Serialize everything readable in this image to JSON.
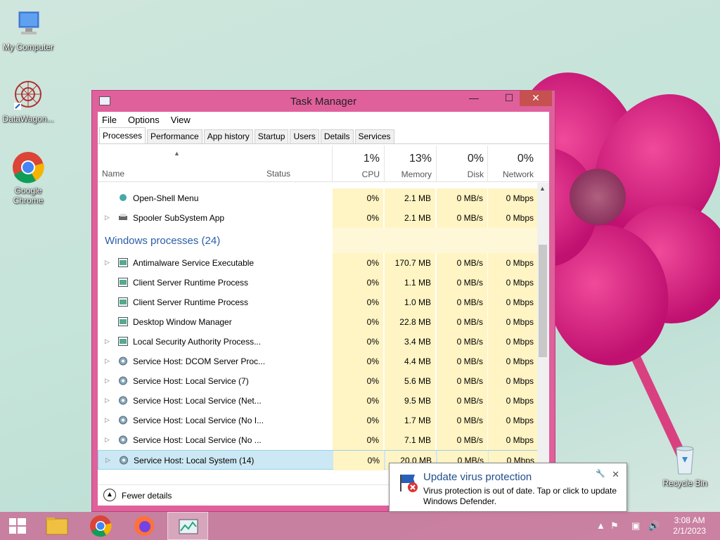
{
  "desktop": {
    "icons": [
      {
        "label": "My Computer"
      },
      {
        "label": "DataWagon..."
      },
      {
        "label": "Google Chrome"
      },
      {
        "label": "Recycle Bin"
      }
    ]
  },
  "window": {
    "title": "Task Manager",
    "controls": {
      "minimize": "—",
      "maximize": "☐",
      "close": "✕"
    },
    "menu": [
      "File",
      "Options",
      "View"
    ],
    "tabs": [
      "Processes",
      "Performance",
      "App history",
      "Startup",
      "Users",
      "Details",
      "Services"
    ],
    "active_tab": "Processes",
    "header": {
      "name": "Name",
      "status": "Status",
      "cpu_pct": "1%",
      "cpu": "CPU",
      "mem_pct": "13%",
      "mem": "Memory",
      "disk_pct": "0%",
      "disk": "Disk",
      "net_pct": "0%",
      "net": "Network"
    },
    "rows_top": [
      {
        "name": "Open-Shell Menu",
        "cpu": "0%",
        "mem": "2.1 MB",
        "disk": "0 MB/s",
        "net": "0 Mbps"
      },
      {
        "name": "Spooler SubSystem App",
        "cpu": "0%",
        "mem": "2.1 MB",
        "disk": "0 MB/s",
        "net": "0 Mbps"
      }
    ],
    "group_label": "Windows processes (24)",
    "rows": [
      {
        "name": "Antimalware Service Executable",
        "cpu": "0%",
        "mem": "170.7 MB",
        "disk": "0 MB/s",
        "net": "0 Mbps"
      },
      {
        "name": "Client Server Runtime Process",
        "cpu": "0%",
        "mem": "1.1 MB",
        "disk": "0 MB/s",
        "net": "0 Mbps"
      },
      {
        "name": "Client Server Runtime Process",
        "cpu": "0%",
        "mem": "1.0 MB",
        "disk": "0 MB/s",
        "net": "0 Mbps"
      },
      {
        "name": "Desktop Window Manager",
        "cpu": "0%",
        "mem": "22.8 MB",
        "disk": "0 MB/s",
        "net": "0 Mbps"
      },
      {
        "name": "Local Security Authority Process...",
        "cpu": "0%",
        "mem": "3.4 MB",
        "disk": "0 MB/s",
        "net": "0 Mbps"
      },
      {
        "name": "Service Host: DCOM Server Proc...",
        "cpu": "0%",
        "mem": "4.4 MB",
        "disk": "0 MB/s",
        "net": "0 Mbps"
      },
      {
        "name": "Service Host: Local Service (7)",
        "cpu": "0%",
        "mem": "5.6 MB",
        "disk": "0 MB/s",
        "net": "0 Mbps"
      },
      {
        "name": "Service Host: Local Service (Net...",
        "cpu": "0%",
        "mem": "9.5 MB",
        "disk": "0 MB/s",
        "net": "0 Mbps"
      },
      {
        "name": "Service Host: Local Service (No I...",
        "cpu": "0%",
        "mem": "1.7 MB",
        "disk": "0 MB/s",
        "net": "0 Mbps"
      },
      {
        "name": "Service Host: Local Service (No ...",
        "cpu": "0%",
        "mem": "7.1 MB",
        "disk": "0 MB/s",
        "net": "0 Mbps"
      },
      {
        "name": "Service Host: Local System (14)",
        "cpu": "0%",
        "mem": "20.0 MB",
        "disk": "0 MB/s",
        "net": "0 Mbps"
      }
    ],
    "footer": {
      "label": "Fewer details"
    }
  },
  "toast": {
    "title": "Update virus protection",
    "body": "Virus protection is out of date. Tap or click to update Windows Defender."
  },
  "taskbar": {
    "time": "3:08 AM",
    "date": "2/1/2023"
  }
}
